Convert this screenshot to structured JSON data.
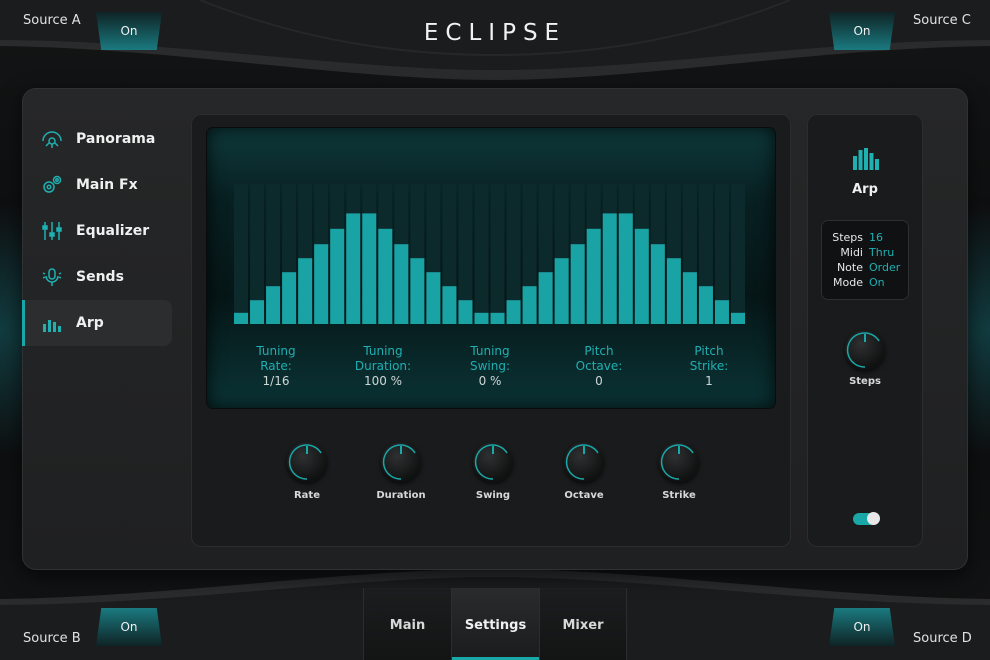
{
  "app": {
    "title": "ECLIPSE"
  },
  "corners": {
    "top_left": {
      "label": "Source A",
      "state": "On"
    },
    "top_right": {
      "label": "Source C",
      "state": "On"
    },
    "bottom_left": {
      "label": "Source B",
      "state": "On"
    },
    "bottom_right": {
      "label": "Source D",
      "state": "On"
    }
  },
  "sidebar": {
    "items": [
      {
        "label": "Panorama",
        "icon": "panorama-icon"
      },
      {
        "label": "Main Fx",
        "icon": "gears-icon"
      },
      {
        "label": "Equalizer",
        "icon": "equalizer-sliders-icon"
      },
      {
        "label": "Sends",
        "icon": "microphone-icon"
      },
      {
        "label": "Arp",
        "icon": "bar-levels-icon",
        "active": true
      }
    ]
  },
  "display": {
    "bars": [
      0.08,
      0.17,
      0.27,
      0.37,
      0.47,
      0.57,
      0.68,
      0.79,
      0.79,
      0.68,
      0.57,
      0.47,
      0.37,
      0.27,
      0.17,
      0.08,
      0.08,
      0.17,
      0.27,
      0.37,
      0.47,
      0.57,
      0.68,
      0.79,
      0.79,
      0.68,
      0.57,
      0.47,
      0.37,
      0.27,
      0.17,
      0.08
    ],
    "params": [
      {
        "line1": "Tuning",
        "line2": "Rate:",
        "value": "1/16"
      },
      {
        "line1": "Tuning",
        "line2": "Duration:",
        "value": "100 %"
      },
      {
        "line1": "Tuning",
        "line2": "Swing:",
        "value": "0 %"
      },
      {
        "line1": "Pitch",
        "line2": "Octave:",
        "value": "0"
      },
      {
        "line1": "Pitch",
        "line2": "Strike:",
        "value": "1"
      }
    ]
  },
  "knobs": [
    {
      "label": "Rate"
    },
    {
      "label": "Duration"
    },
    {
      "label": "Swing"
    },
    {
      "label": "Octave"
    },
    {
      "label": "Strike"
    }
  ],
  "arp_panel": {
    "title": "Arp",
    "icon": "bar-levels-icon",
    "info": [
      {
        "key": "Steps",
        "value": "16"
      },
      {
        "key": "Midi",
        "value": "Thru"
      },
      {
        "key": "Note",
        "value": "Order"
      },
      {
        "key": "Mode",
        "value": "On"
      }
    ],
    "steps_label": "Steps",
    "toggle_on": true
  },
  "tabs": [
    {
      "label": "Main"
    },
    {
      "label": "Settings",
      "active": true
    },
    {
      "label": "Mixer"
    }
  ],
  "colors": {
    "accent": "#19a7a8",
    "accent_text": "#1fb0b2",
    "bar": "#1aa3a4",
    "bar_track": "#0c2a2b"
  }
}
